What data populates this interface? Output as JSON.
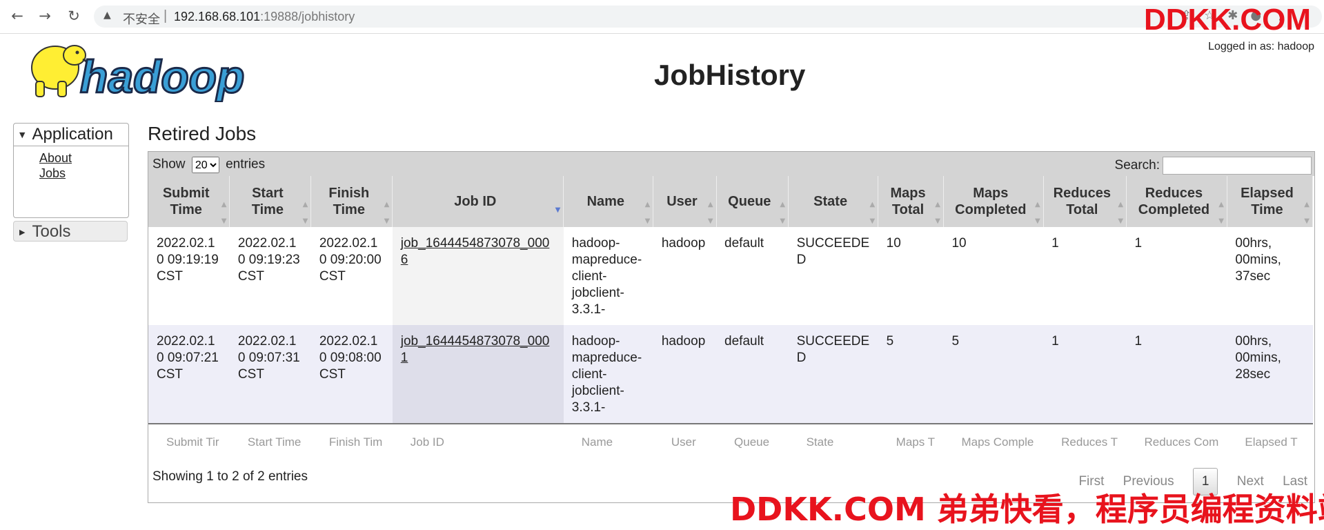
{
  "browser": {
    "insecure_label": "不安全",
    "separator": "|",
    "host": "192.168.68.101",
    "path": ":19888/jobhistory",
    "icons": [
      "back-icon",
      "forward-icon",
      "reload-icon",
      "warning-icon"
    ]
  },
  "watermark": {
    "top": "DDKK.COM",
    "bottom": "DDKK.COM 弟弟快看，程序员编程资料站"
  },
  "header": {
    "logo_text": "hadoop",
    "title": "JobHistory",
    "logged_in": "Logged in as: hadoop"
  },
  "sidebar": {
    "application": {
      "label": "Application",
      "links": [
        "About",
        "Jobs"
      ]
    },
    "tools": {
      "label": "Tools"
    }
  },
  "main": {
    "section_title": "Retired Jobs",
    "show_label": "Show",
    "entries_value": "20",
    "entries_label": "entries",
    "search_label": "Search:",
    "search_value": "",
    "columns": [
      "Submit Time",
      "Start Time",
      "Finish Time",
      "Job ID",
      "Name",
      "User",
      "Queue",
      "State",
      "Maps Total",
      "Maps Completed",
      "Reduces Total",
      "Reduces Completed",
      "Elapsed Time"
    ],
    "footer_columns": [
      "Submit Tir",
      "Start Time",
      "Finish Tim",
      "Job ID",
      "Name",
      "User",
      "Queue",
      "State",
      "Maps T",
      "Maps Comple",
      "Reduces T",
      "Reduces Com",
      "Elapsed T"
    ],
    "rows": [
      [
        "2022.02.10 09:19:19 CST",
        "2022.02.10 09:19:23 CST",
        "2022.02.10 09:20:00 CST",
        "job_1644454873078_0006",
        "hadoop-mapreduce-client-jobclient-3.3.1-",
        "hadoop",
        "default",
        "SUCCEEDED",
        "10",
        "10",
        "1",
        "1",
        "00hrs, 00mins, 37sec"
      ],
      [
        "2022.02.10 09:07:21 CST",
        "2022.02.10 09:07:31 CST",
        "2022.02.10 09:08:00 CST",
        "job_1644454873078_0001",
        "hadoop-mapreduce-client-jobclient-3.3.1-",
        "hadoop",
        "default",
        "SUCCEEDED",
        "5",
        "5",
        "1",
        "1",
        "00hrs, 00mins, 28sec"
      ]
    ],
    "info": "Showing 1 to 2 of 2 entries",
    "pager": {
      "first": "First",
      "previous": "Previous",
      "current": "1",
      "next": "Next",
      "last": "Last"
    }
  }
}
